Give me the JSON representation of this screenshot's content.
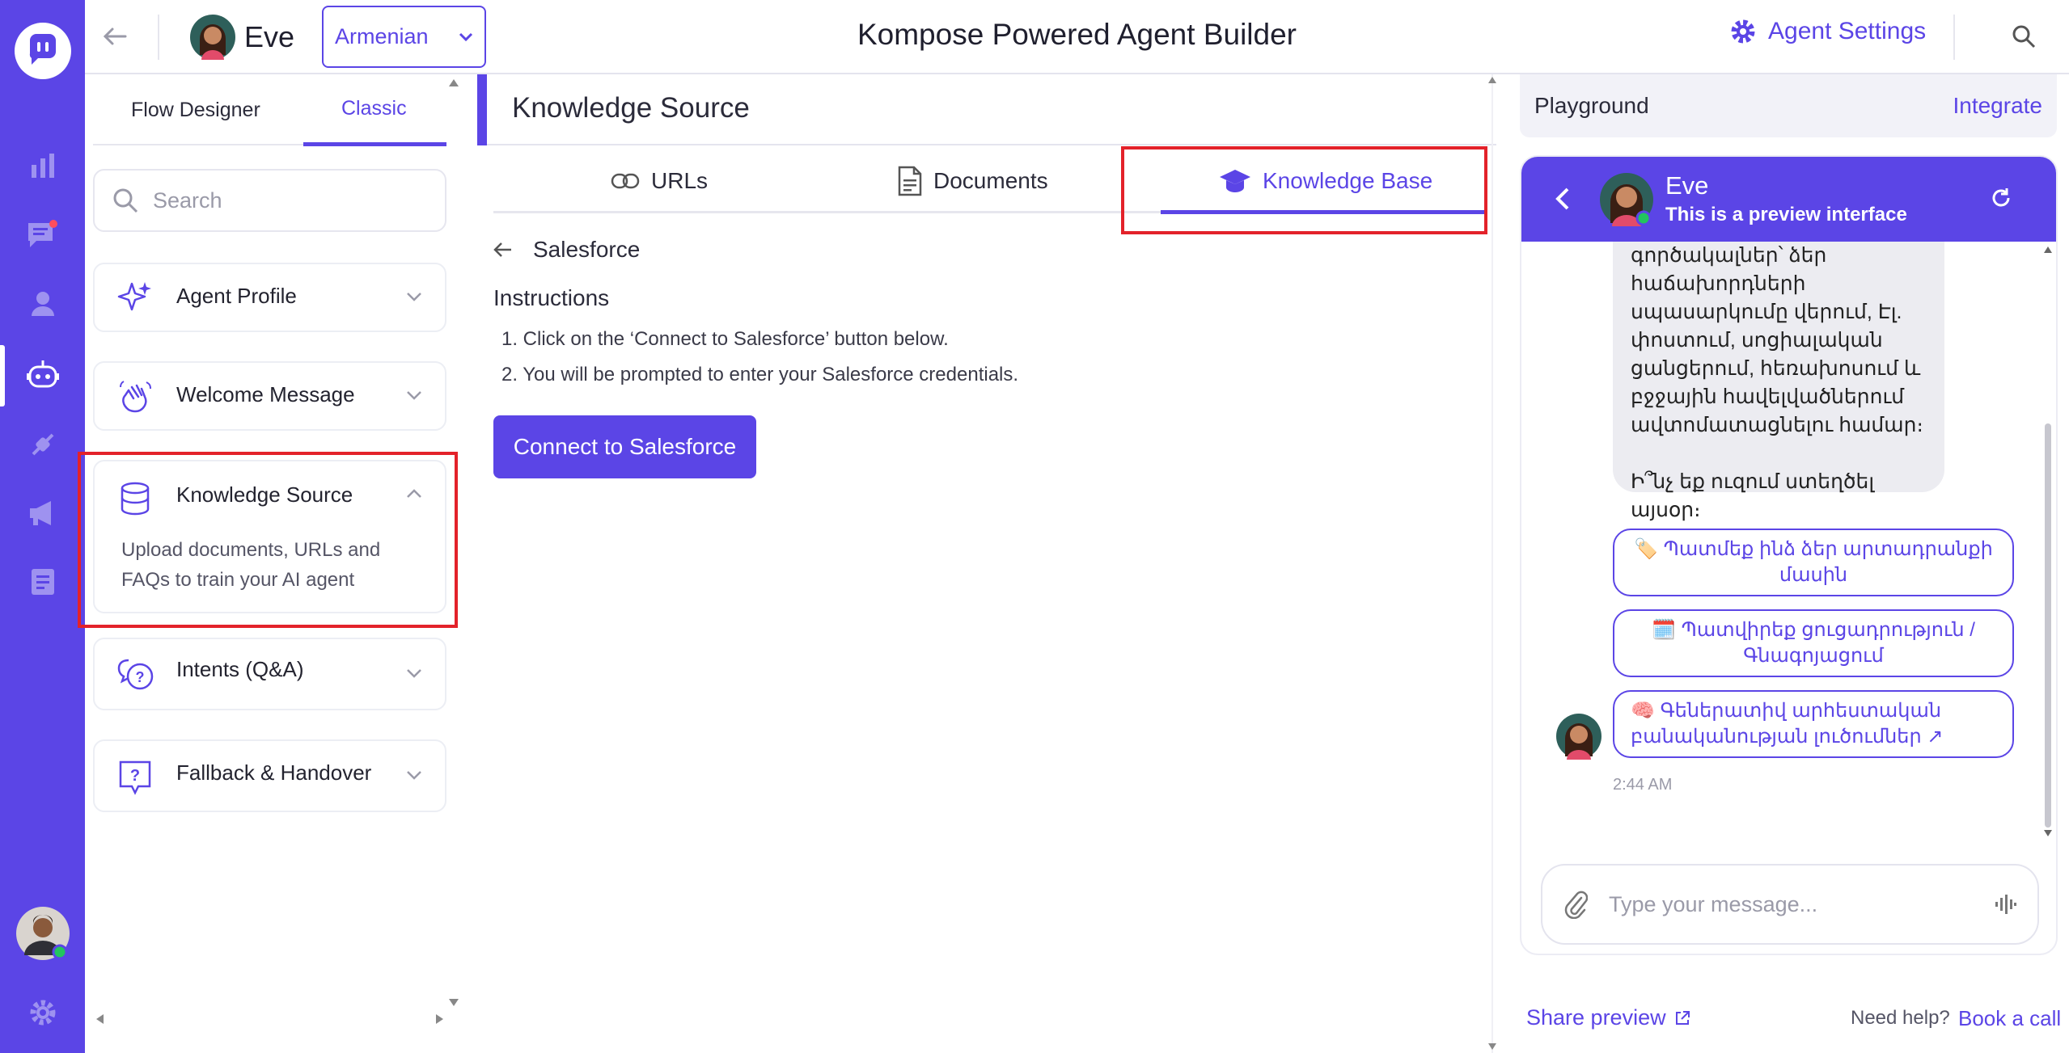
{
  "header": {
    "agent_name": "Eve",
    "language": "Armenian",
    "title": "Kompose Powered Agent Builder",
    "agent_settings": "Agent Settings"
  },
  "left_panel": {
    "tabs": [
      {
        "label": "Flow Designer"
      },
      {
        "label": "Classic"
      }
    ],
    "search_placeholder": "Search",
    "cards": {
      "agent_profile": "Agent Profile",
      "welcome_message": "Welcome Message",
      "knowledge_source": "Knowledge Source",
      "knowledge_source_desc_1": "Upload documents, URLs and",
      "knowledge_source_desc_2": "FAQs to train your AI agent",
      "intents": "Intents (Q&A)",
      "fallback": "Fallback & Handover"
    }
  },
  "center": {
    "section_title": "Knowledge Source",
    "tabs": [
      {
        "label": "URLs"
      },
      {
        "label": "Documents"
      },
      {
        "label": "Knowledge Base"
      }
    ],
    "breadcrumb": "Salesforce",
    "instructions_title": "Instructions",
    "steps": [
      "1. Click on the ‘Connect to Salesforce’ button below.",
      "2. You will be prompted to enter your Salesforce credentials."
    ],
    "connect_button": "Connect to Salesforce"
  },
  "playground": {
    "title": "Playground",
    "integrate": "Integrate",
    "chat_name": "Eve",
    "chat_subtitle": "This is a preview interface",
    "bot_lines": [
      "գործակալներ՝ ձեր",
      "հաճախորդների",
      "սպասարկումը վերում, Էլ.",
      "փոստում, սոցիալական",
      "ցանցերում, հեռախոսում և",
      "բջջային հավելվածներում",
      "ավտոմատացնելու համար։"
    ],
    "bot_question": "Ի՞նչ եք ուզում ստեղծել այսօր։",
    "quick_replies": [
      {
        "emoji": "🏷️",
        "line1": "Պատմեք ինձ ձեր արտադրանքի",
        "line2": "մասին"
      },
      {
        "emoji": "🗓️",
        "line1": "Պատվիրեք ցուցադրություն /",
        "line2": "Գնագոյացում"
      },
      {
        "emoji": "🧠",
        "line1": "Գեներատիվ արհեստական",
        "line2": "բանականության լուծումներ"
      }
    ],
    "timestamp": "2:44 AM",
    "input_placeholder": "Type your message...",
    "share_preview": "Share preview",
    "need_help": "Need help?",
    "book_call": "Book a call"
  },
  "colors": {
    "brand": "#5b45e6",
    "highlight": "#e3222a",
    "online": "#22c55e"
  }
}
